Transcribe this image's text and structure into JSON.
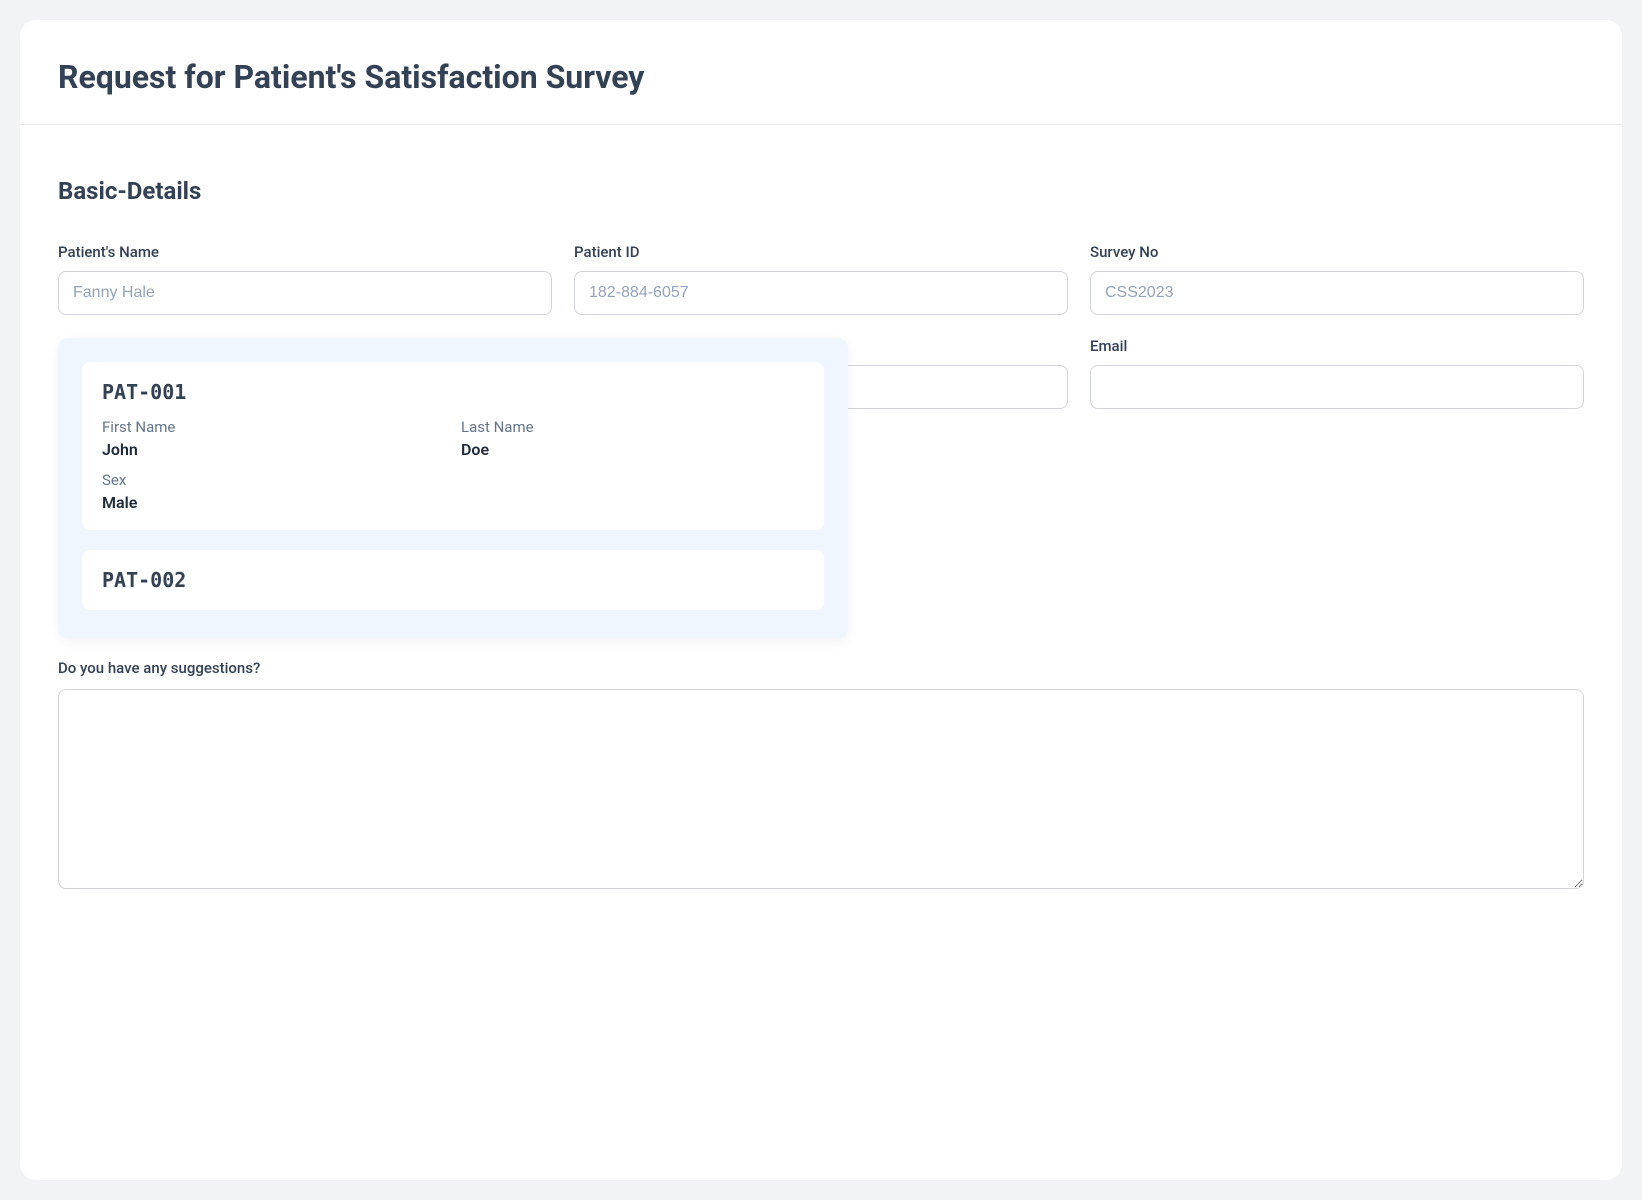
{
  "header": {
    "title": "Request for Patient's Satisfaction Survey"
  },
  "section": {
    "title": "Basic-Details"
  },
  "fields": {
    "patient_name": {
      "label": "Patient's Name",
      "placeholder": "Fanny Hale",
      "value": ""
    },
    "patient_id": {
      "label": "Patient ID",
      "placeholder": "182-884-6057",
      "value": ""
    },
    "survey_no": {
      "label": "Survey No",
      "placeholder": "CSS2023",
      "value": ""
    },
    "email": {
      "label": "Email",
      "placeholder": "",
      "value": ""
    }
  },
  "suggestions": {
    "label": "Do you have any suggestions?",
    "value": ""
  },
  "dropdown": {
    "options": [
      {
        "id": "PAT-001",
        "fields": [
          {
            "label": "First Name",
            "value": "John"
          },
          {
            "label": "Last Name",
            "value": "Doe"
          },
          {
            "label": "Sex",
            "value": "Male"
          }
        ]
      },
      {
        "id": "PAT-002",
        "fields": []
      }
    ]
  }
}
